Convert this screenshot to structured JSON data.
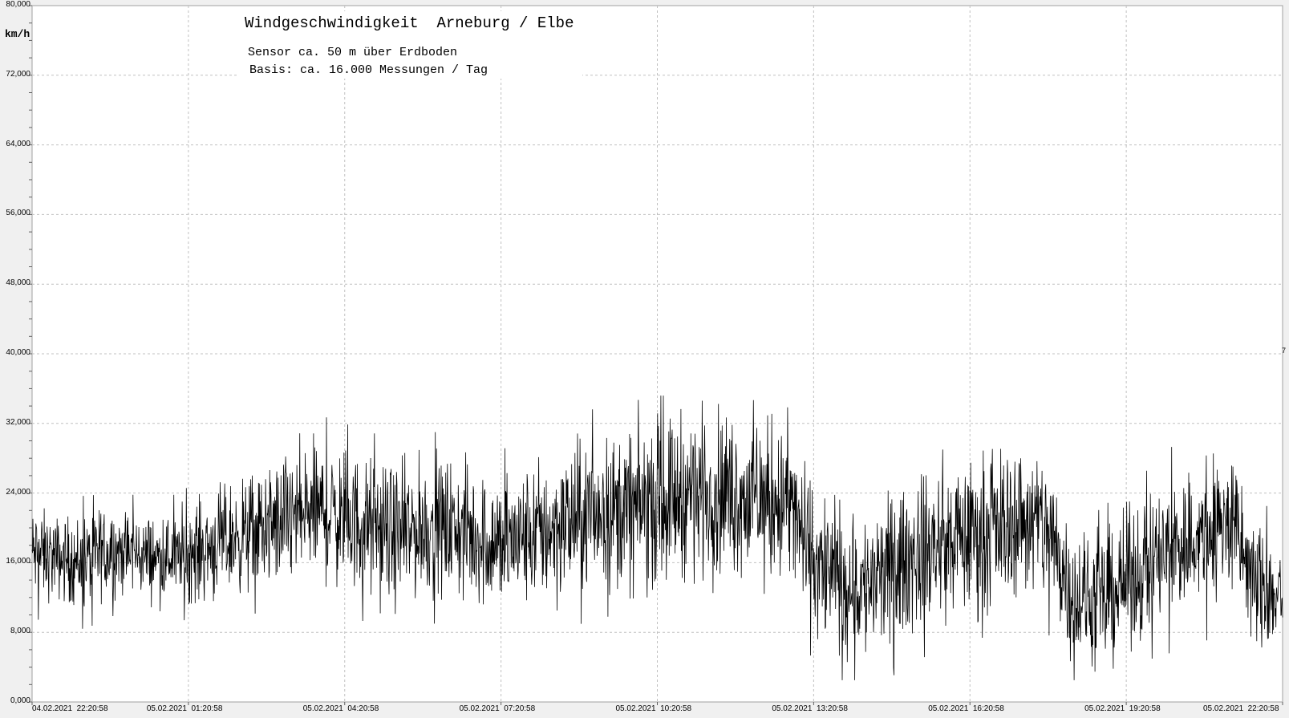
{
  "title": "Windgeschwindigkeit  Arneburg / Elbe",
  "subtitle1": "Sensor ca. 50 m über Erdboden",
  "subtitle2": "Basis: ca. 16.000 Messungen / Tag",
  "unit": "km/h",
  "right_mark": "7",
  "colors": {
    "line": "#000000",
    "grid": "#c0c0c0",
    "plot_bg": "#ffffff",
    "frame_bg": "#f0f0f0"
  },
  "chart_data": {
    "type": "line",
    "title": "Windgeschwindigkeit  Arneburg / Elbe",
    "ylabel": "km/h",
    "ylim": [
      0,
      80
    ],
    "grid": true,
    "y_ticks": [
      "0,000",
      "8,000",
      "16,000",
      "24,000",
      "32,000",
      "40,000",
      "48,000",
      "56,000",
      "64,000",
      "72,000",
      "80,000"
    ],
    "x_ticks": [
      {
        "label": "04.02.2021  22:20:58",
        "hour": 0
      },
      {
        "label": "05.02.2021  01:20:58",
        "hour": 3
      },
      {
        "label": "05.02.2021  04:20:58",
        "hour": 6
      },
      {
        "label": "05.02.2021  07:20:58",
        "hour": 9
      },
      {
        "label": "05.02.2021  10:20:58",
        "hour": 12
      },
      {
        "label": "05.02.2021  13:20:58",
        "hour": 15
      },
      {
        "label": "05.02.2021  16:20:58",
        "hour": 18
      },
      {
        "label": "05.02.2021  19:20:58",
        "hour": 21
      },
      {
        "label": "05.02.2021  22:20:58",
        "hour": 24
      }
    ],
    "series": [
      {
        "x": [
          0,
          0.5,
          1,
          1.5,
          2,
          2.5,
          3,
          3.5,
          4,
          4.5,
          5,
          5.5,
          6,
          6.5,
          7,
          7.5,
          8,
          8.5,
          9,
          9.5,
          10,
          10.5,
          11,
          11.5,
          12,
          12.5,
          13,
          13.5,
          14,
          14.5,
          15,
          15.5,
          16,
          16.5,
          17,
          17.5,
          18,
          18.5,
          19,
          19.5,
          20,
          20.5,
          21,
          21.5,
          22,
          22.5,
          23,
          23.5,
          24
        ],
        "y": [
          17,
          16.5,
          16,
          17.5,
          17,
          16.5,
          17,
          18,
          19,
          20,
          21,
          22,
          21,
          20,
          19,
          20,
          20,
          19,
          18,
          19,
          20,
          21,
          22,
          22,
          23,
          24,
          24,
          24,
          23,
          23,
          16,
          14,
          13,
          15,
          17,
          18,
          19,
          20,
          21,
          20,
          12,
          11,
          14,
          16,
          18,
          19,
          21,
          13,
          12
        ],
        "spread": [
          3.5,
          3,
          3.5,
          3.5,
          3,
          3,
          3.5,
          4,
          4,
          4.5,
          5,
          5,
          5,
          5,
          5,
          5,
          5,
          5,
          5,
          5,
          5.5,
          5.5,
          5.5,
          6,
          6,
          6,
          6,
          6,
          6,
          6,
          5.5,
          5.5,
          5.5,
          5.5,
          5.5,
          5.5,
          5.5,
          5.5,
          5.5,
          5.5,
          5,
          5,
          5,
          5,
          5.5,
          5.5,
          5.5,
          4.5,
          4.5
        ],
        "min": 2.5,
        "max": 35.2
      }
    ]
  }
}
